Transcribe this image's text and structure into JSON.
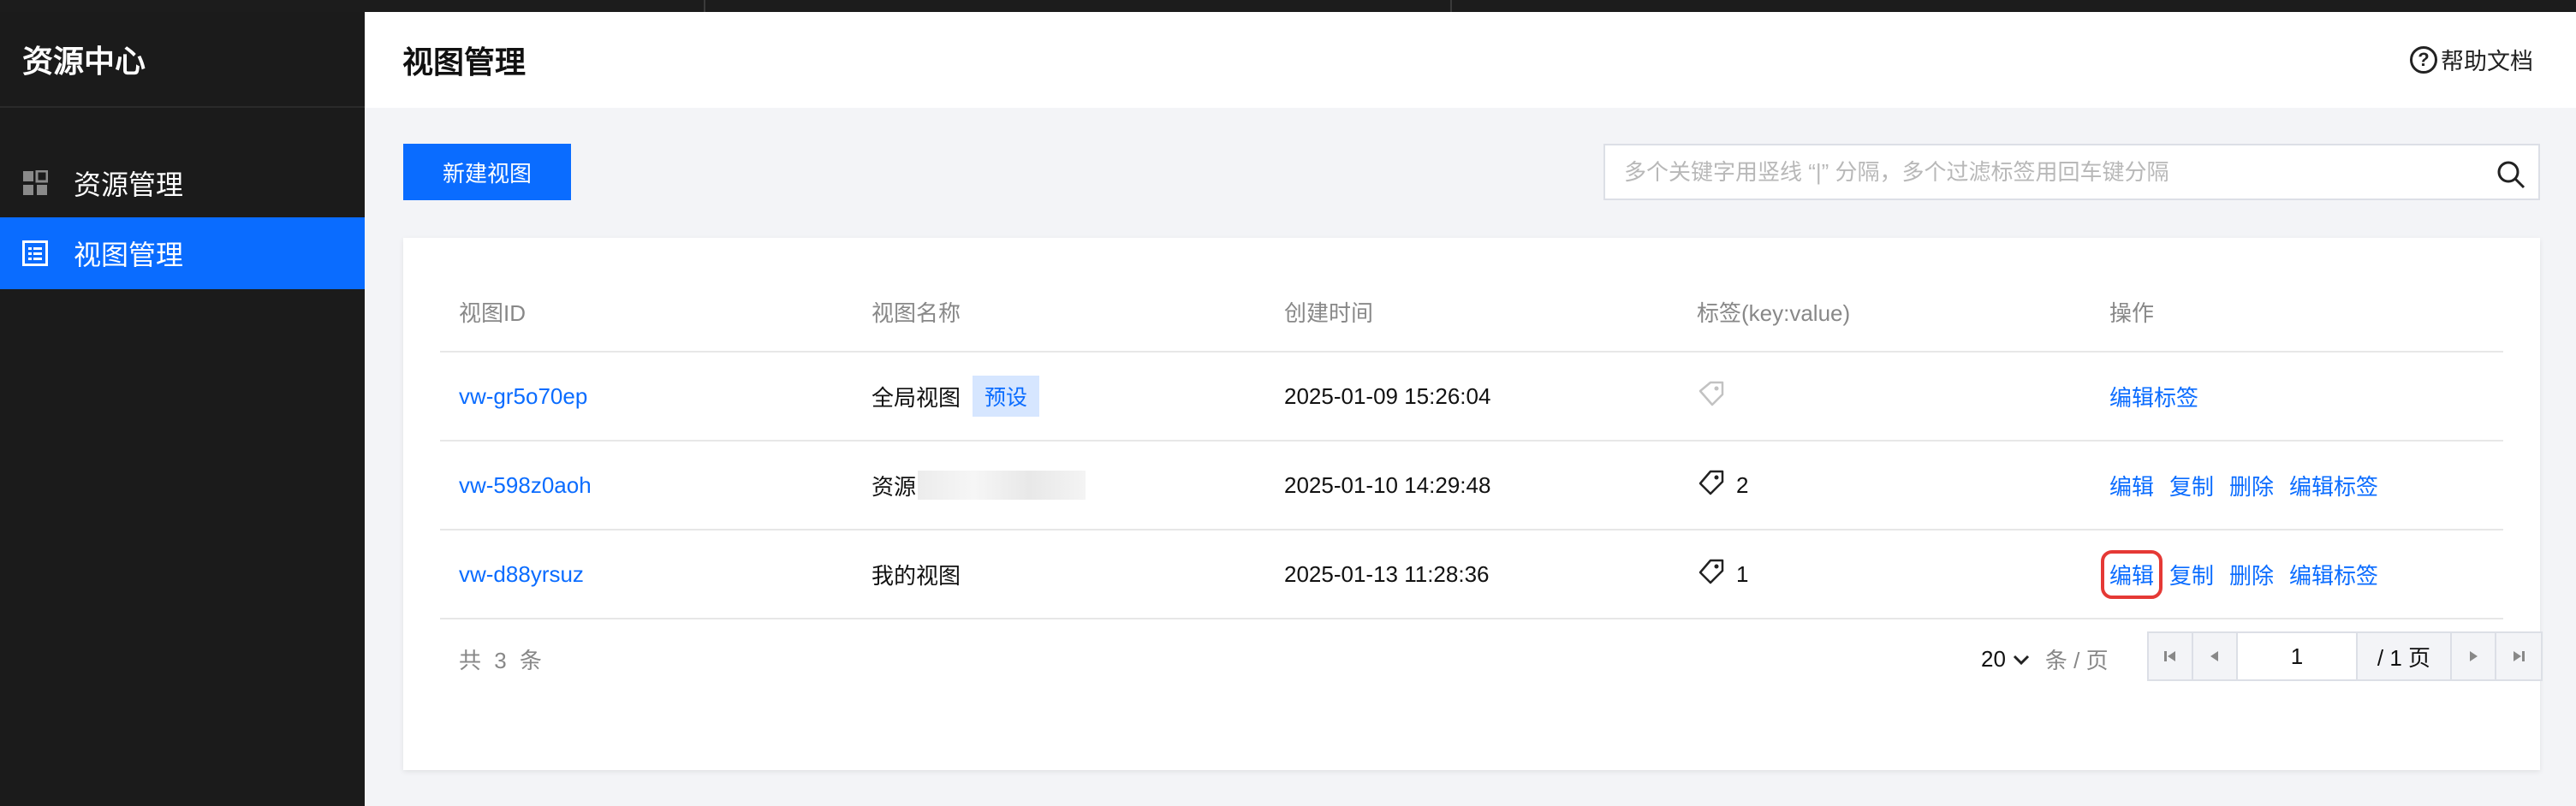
{
  "sidebar": {
    "title": "资源中心",
    "items": [
      {
        "label": "资源管理",
        "icon": "grid-icon",
        "active": false
      },
      {
        "label": "视图管理",
        "icon": "list-icon",
        "active": true
      }
    ]
  },
  "header": {
    "title": "视图管理",
    "help_label": "帮助文档"
  },
  "toolbar": {
    "new_button": "新建视图",
    "search_placeholder": "多个关键字用竖线 “|” 分隔，多个过滤标签用回车键分隔"
  },
  "table": {
    "columns": [
      "视图ID",
      "视图名称",
      "创建时间",
      "标签(key:value)",
      "操作"
    ],
    "rows": [
      {
        "id": "vw-gr5o70ep",
        "name": "全局视图",
        "badge": "预设",
        "created": "2025-01-09 15:26:04",
        "tag_count": "",
        "actions": [
          "编辑标签"
        ]
      },
      {
        "id": "vw-598z0aoh",
        "name": "资源",
        "badge": "",
        "created": "2025-01-10 14:29:48",
        "tag_count": "2",
        "actions": [
          "编辑",
          "复制",
          "删除",
          "编辑标签"
        ]
      },
      {
        "id": "vw-d88yrsuz",
        "name": "我的视图",
        "badge": "",
        "created": "2025-01-13 11:28:36",
        "tag_count": "1",
        "actions": [
          "编辑",
          "复制",
          "删除",
          "编辑标签"
        ]
      }
    ]
  },
  "pagination": {
    "total_text": "共 3 条",
    "page_size": "20",
    "page_size_unit": "条 / 页",
    "current_page": "1",
    "total_pages": "/ 1 页"
  },
  "colors": {
    "accent": "#0a6cff",
    "sidebar_bg": "#1b1b1b",
    "highlight": "#e53935"
  }
}
